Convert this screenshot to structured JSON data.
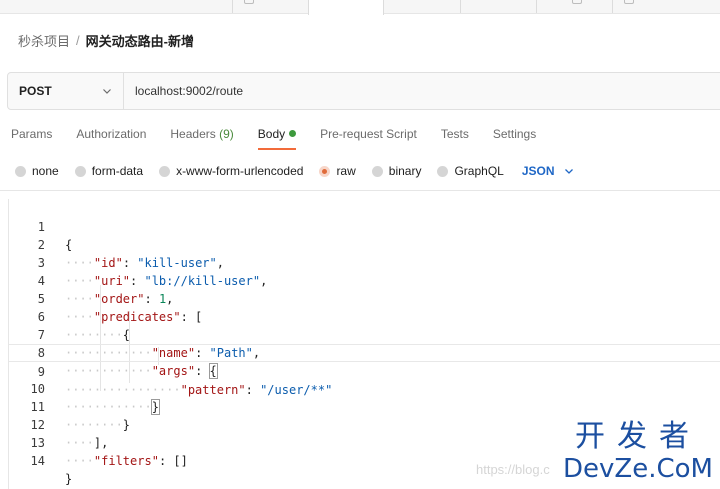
{
  "breadcrumb": {
    "parent": "秒杀项目",
    "separator": "/",
    "current": "网关动态路由-新增"
  },
  "request": {
    "method": "POST",
    "url": "localhost:9002/route"
  },
  "tabs": {
    "params": "Params",
    "authorization": "Authorization",
    "headers": "Headers",
    "headers_count": "(9)",
    "body": "Body",
    "prerequest": "Pre-request Script",
    "tests": "Tests",
    "settings": "Settings",
    "active": "Body"
  },
  "body_types": {
    "none": "none",
    "form_data": "form-data",
    "urlencoded": "x-www-form-urlencoded",
    "raw": "raw",
    "binary": "binary",
    "graphql": "GraphQL",
    "selected": "raw",
    "format": "JSON"
  },
  "editor": {
    "lines": [
      {
        "n": "1"
      },
      {
        "n": "2"
      },
      {
        "n": "3"
      },
      {
        "n": "4"
      },
      {
        "n": "5"
      },
      {
        "n": "6"
      },
      {
        "n": "7"
      },
      {
        "n": "8"
      },
      {
        "n": "9"
      },
      {
        "n": "10"
      },
      {
        "n": "11"
      },
      {
        "n": "12"
      },
      {
        "n": "13"
      },
      {
        "n": "14"
      }
    ],
    "tokens": {
      "id_key": "\"id\"",
      "id_val": "\"kill-user\"",
      "uri_key": "\"uri\"",
      "uri_val": "\"lb://kill-user\"",
      "order_key": "\"order\"",
      "order_val": "1",
      "predicates_key": "\"predicates\"",
      "name_key": "\"name\"",
      "name_val": "\"Path\"",
      "args_key": "\"args\"",
      "pattern_key": "\"pattern\"",
      "pattern_val": "\"/user/**\"",
      "filters_key": "\"filters\""
    },
    "highlighted_line": "9"
  },
  "watermark": {
    "url": "https://blog.c",
    "logo_cn": "开发者",
    "logo_en": "DevZe.CoM"
  },
  "colors": {
    "accent": "#f26b3a",
    "json_string": "#0b5cad",
    "json_key": "#a31515",
    "format_link": "#1f67c6",
    "status_green": "#3d9a3d"
  }
}
